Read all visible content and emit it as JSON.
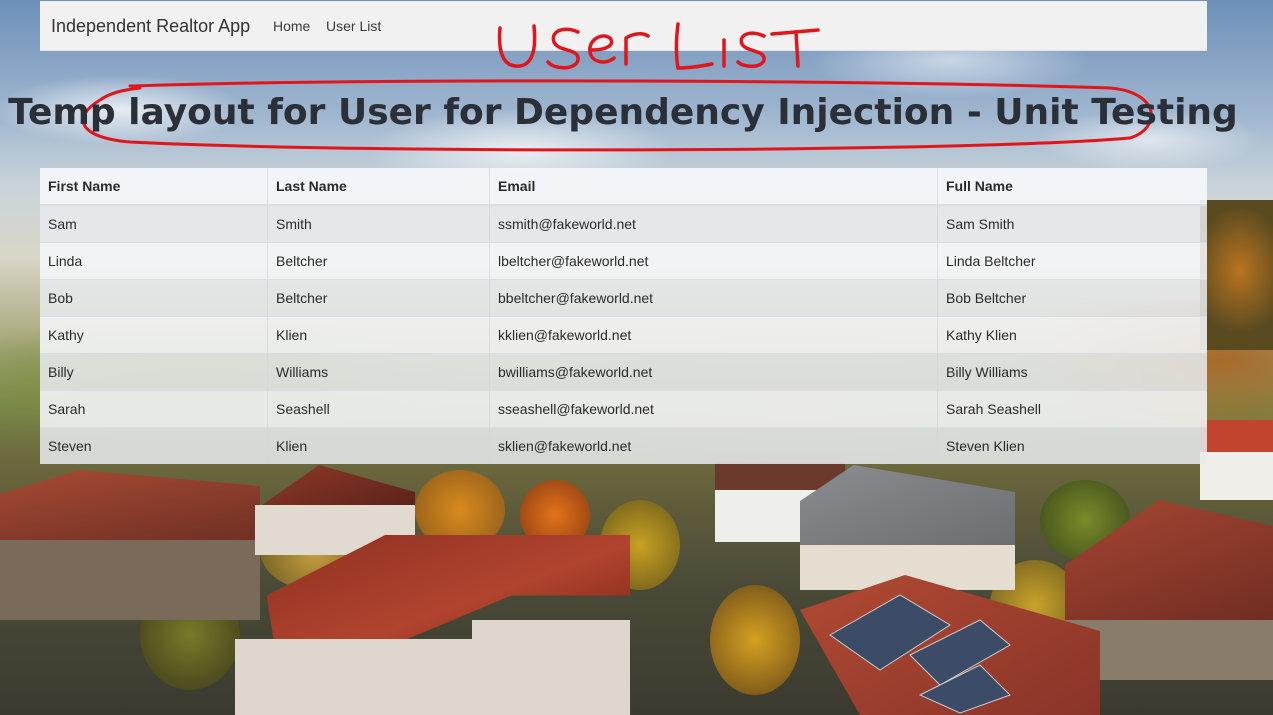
{
  "navbar": {
    "brand": "Independent Realtor App",
    "links": [
      {
        "label": "Home"
      },
      {
        "label": "User List"
      }
    ]
  },
  "annotation": {
    "text": "USER LIST",
    "color": "#e0161c"
  },
  "page": {
    "title": "Temp layout for User for Dependency Injection - Unit Testing"
  },
  "table": {
    "headers": [
      "First Name",
      "Last Name",
      "Email",
      "Full Name"
    ],
    "rows": [
      [
        "Sam",
        "Smith",
        "ssmith@fakeworld.net",
        "Sam Smith"
      ],
      [
        "Linda",
        "Beltcher",
        "lbeltcher@fakeworld.net",
        "Linda Beltcher"
      ],
      [
        "Bob",
        "Beltcher",
        "bbeltcher@fakeworld.net",
        "Bob Beltcher"
      ],
      [
        "Kathy",
        "Klien",
        "kklien@fakeworld.net",
        "Kathy Klien"
      ],
      [
        "Billy",
        "Williams",
        "bwilliams@fakeworld.net",
        "Billy Williams"
      ],
      [
        "Sarah",
        "Seashell",
        "sseashell@fakeworld.net",
        "Sarah Seashell"
      ],
      [
        "Steven",
        "Klien",
        "sklien@fakeworld.net",
        "Steven Klien"
      ]
    ]
  }
}
